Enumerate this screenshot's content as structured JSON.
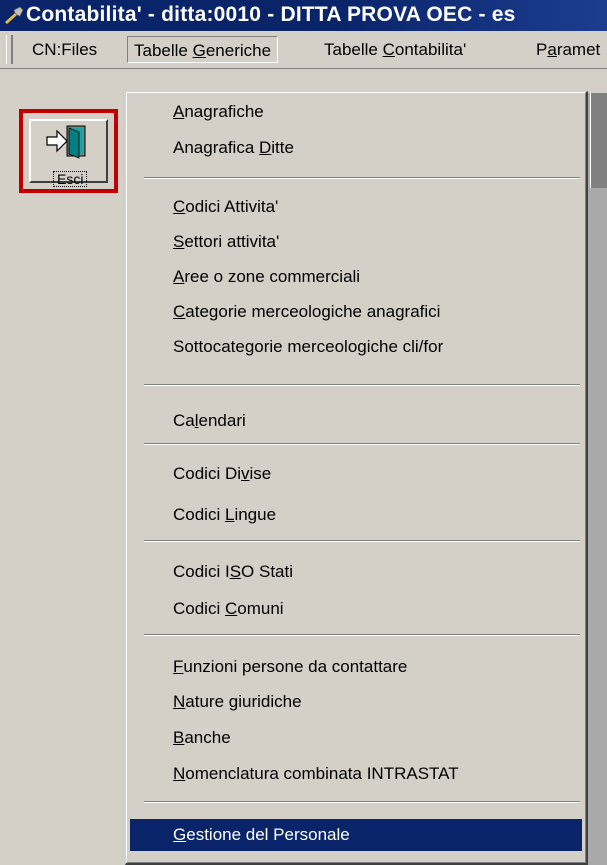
{
  "window": {
    "title": "Contabilita' - ditta:0010 - DITTA PROVA OEC - es"
  },
  "menubar": {
    "items": [
      {
        "pre": "CN:Files",
        "acc": "",
        "post": ""
      },
      {
        "pre": "Tabelle ",
        "acc": "G",
        "post": "eneriche"
      },
      {
        "pre": "Tabelle ",
        "acc": "C",
        "post": "ontabilita'"
      },
      {
        "pre": "P",
        "acc": "a",
        "post": "ramet"
      }
    ]
  },
  "toolbar": {
    "esci_label": "Esci"
  },
  "dropdown": {
    "items": [
      {
        "pre": "",
        "acc": "A",
        "post": "nagrafiche"
      },
      {
        "pre": "Anagrafica ",
        "acc": "D",
        "post": "itte"
      },
      {
        "pre": "",
        "acc": "C",
        "post": "odici Attivita'"
      },
      {
        "pre": "",
        "acc": "S",
        "post": "ettori attivita'"
      },
      {
        "pre": "",
        "acc": "A",
        "post": "ree o zone commerciali"
      },
      {
        "pre": "",
        "acc": "C",
        "post": "ategorie merceologiche anagrafici"
      },
      {
        "pre": "Sottocategorie merceologiche cli/for",
        "acc": "",
        "post": ""
      },
      {
        "pre": "Ca",
        "acc": "l",
        "post": "endari"
      },
      {
        "pre": "Codici Di",
        "acc": "v",
        "post": "ise"
      },
      {
        "pre": "Codici ",
        "acc": "L",
        "post": "ingue"
      },
      {
        "pre": "Codici I",
        "acc": "S",
        "post": "O Stati"
      },
      {
        "pre": "Codici ",
        "acc": "C",
        "post": "omuni"
      },
      {
        "pre": "",
        "acc": "F",
        "post": "unzioni persone da contattare"
      },
      {
        "pre": "",
        "acc": "N",
        "post": "ature giuridiche"
      },
      {
        "pre": "",
        "acc": "B",
        "post": "anche"
      },
      {
        "pre": "",
        "acc": "N",
        "post": "omenclatura combinata INTRASTAT"
      },
      {
        "pre": "",
        "acc": "G",
        "post": "estione del Personale"
      }
    ],
    "selected_index": 16
  },
  "colors": {
    "title_bar": "#0a246a",
    "selection": "#0a246a",
    "esci_border": "#c00000",
    "face": "#d4d0c8"
  }
}
